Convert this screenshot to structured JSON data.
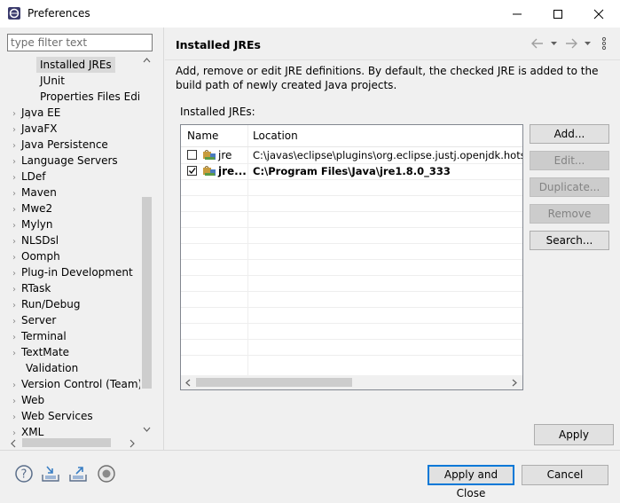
{
  "window": {
    "title": "Preferences"
  },
  "sidebar": {
    "filter_placeholder": "type filter text",
    "items": [
      {
        "label": "Installed JREs",
        "selected": true
      },
      {
        "label": "JUnit"
      },
      {
        "label": "Properties Files Editor"
      },
      {
        "label": "Java EE"
      },
      {
        "label": "JavaFX"
      },
      {
        "label": "Java Persistence"
      },
      {
        "label": "Language Servers"
      },
      {
        "label": "LDef"
      },
      {
        "label": "Maven"
      },
      {
        "label": "Mwe2"
      },
      {
        "label": "Mylyn"
      },
      {
        "label": "NLSDsl"
      },
      {
        "label": "Oomph"
      },
      {
        "label": "Plug-in Development"
      },
      {
        "label": "RTask"
      },
      {
        "label": "Run/Debug"
      },
      {
        "label": "Server"
      },
      {
        "label": "Terminal"
      },
      {
        "label": "TextMate"
      },
      {
        "label": "Validation"
      },
      {
        "label": "Version Control (Team)"
      },
      {
        "label": "Web"
      },
      {
        "label": "Web Services"
      },
      {
        "label": "XML"
      }
    ]
  },
  "main": {
    "title": "Installed JREs",
    "description": "Add, remove or edit JRE definitions. By default, the checked JRE is added to the build path of newly created Java projects.",
    "list_label": "Installed JREs:",
    "table": {
      "columns": [
        "Name",
        "Location"
      ],
      "rows": [
        {
          "name": "jre",
          "location": "C:\\javas\\eclipse\\plugins\\org.eclipse.justj.openjdk.hotspot",
          "checked": false
        },
        {
          "name": "jre...",
          "location": "C:\\Program Files\\Java\\jre1.8.0_333",
          "checked": true
        }
      ]
    },
    "buttons": {
      "add": "Add...",
      "edit": "Edit...",
      "duplicate": "Duplicate...",
      "remove": "Remove",
      "search": "Search..."
    },
    "apply": "Apply"
  },
  "footer": {
    "apply_close": "Apply and Close",
    "cancel": "Cancel"
  },
  "colors": {
    "selection": "#d9d9d9",
    "accent": "#0078d7"
  }
}
